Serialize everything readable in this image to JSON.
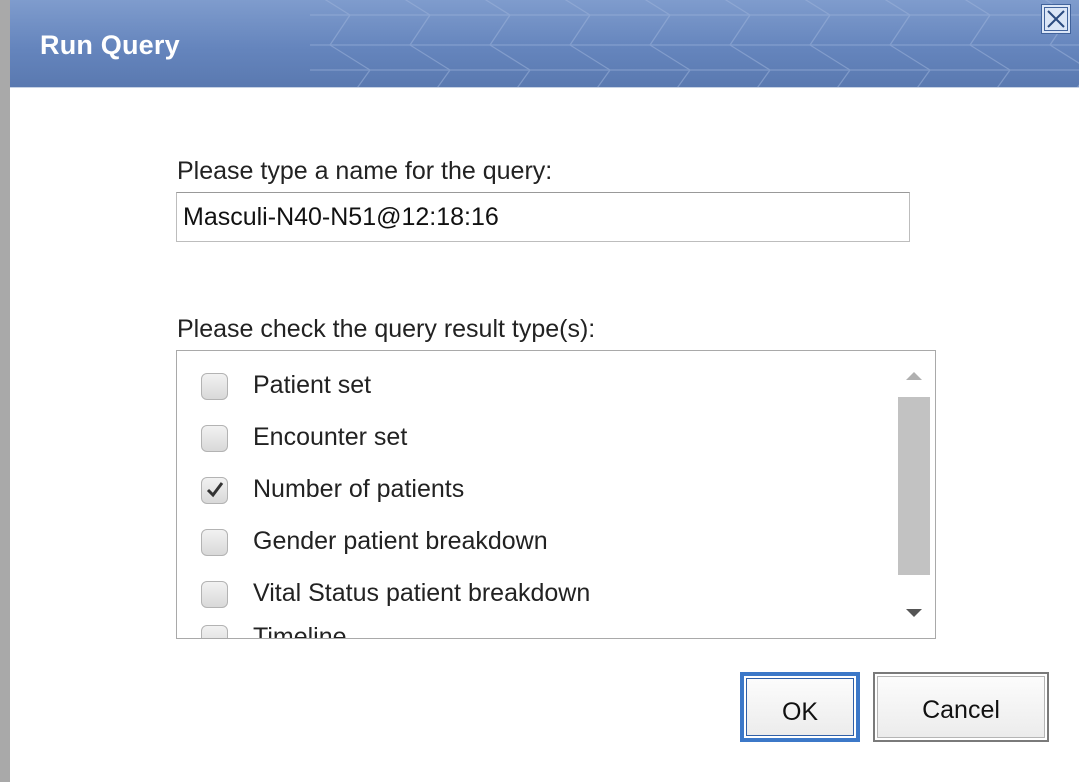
{
  "dialog": {
    "title": "Run Query",
    "close_icon": "close-icon"
  },
  "query_name": {
    "label": "Please type a name for the query:",
    "value": "Masculi-N40-N51@12:18:16"
  },
  "result_types": {
    "label": "Please check the query result type(s):",
    "items": [
      {
        "label": "Patient set",
        "checked": false
      },
      {
        "label": "Encounter set",
        "checked": false
      },
      {
        "label": "Number of patients",
        "checked": true
      },
      {
        "label": "Gender patient breakdown",
        "checked": false
      },
      {
        "label": "Vital Status patient breakdown",
        "checked": false
      },
      {
        "label": "Timeline",
        "checked": false
      }
    ]
  },
  "buttons": {
    "ok_label": "OK",
    "cancel_label": "Cancel"
  },
  "colors": {
    "title_bar": "#6585bd",
    "title_text": "#ffffff",
    "ok_border": "#3c78c8",
    "scroll_thumb": "#c2c2c2"
  }
}
